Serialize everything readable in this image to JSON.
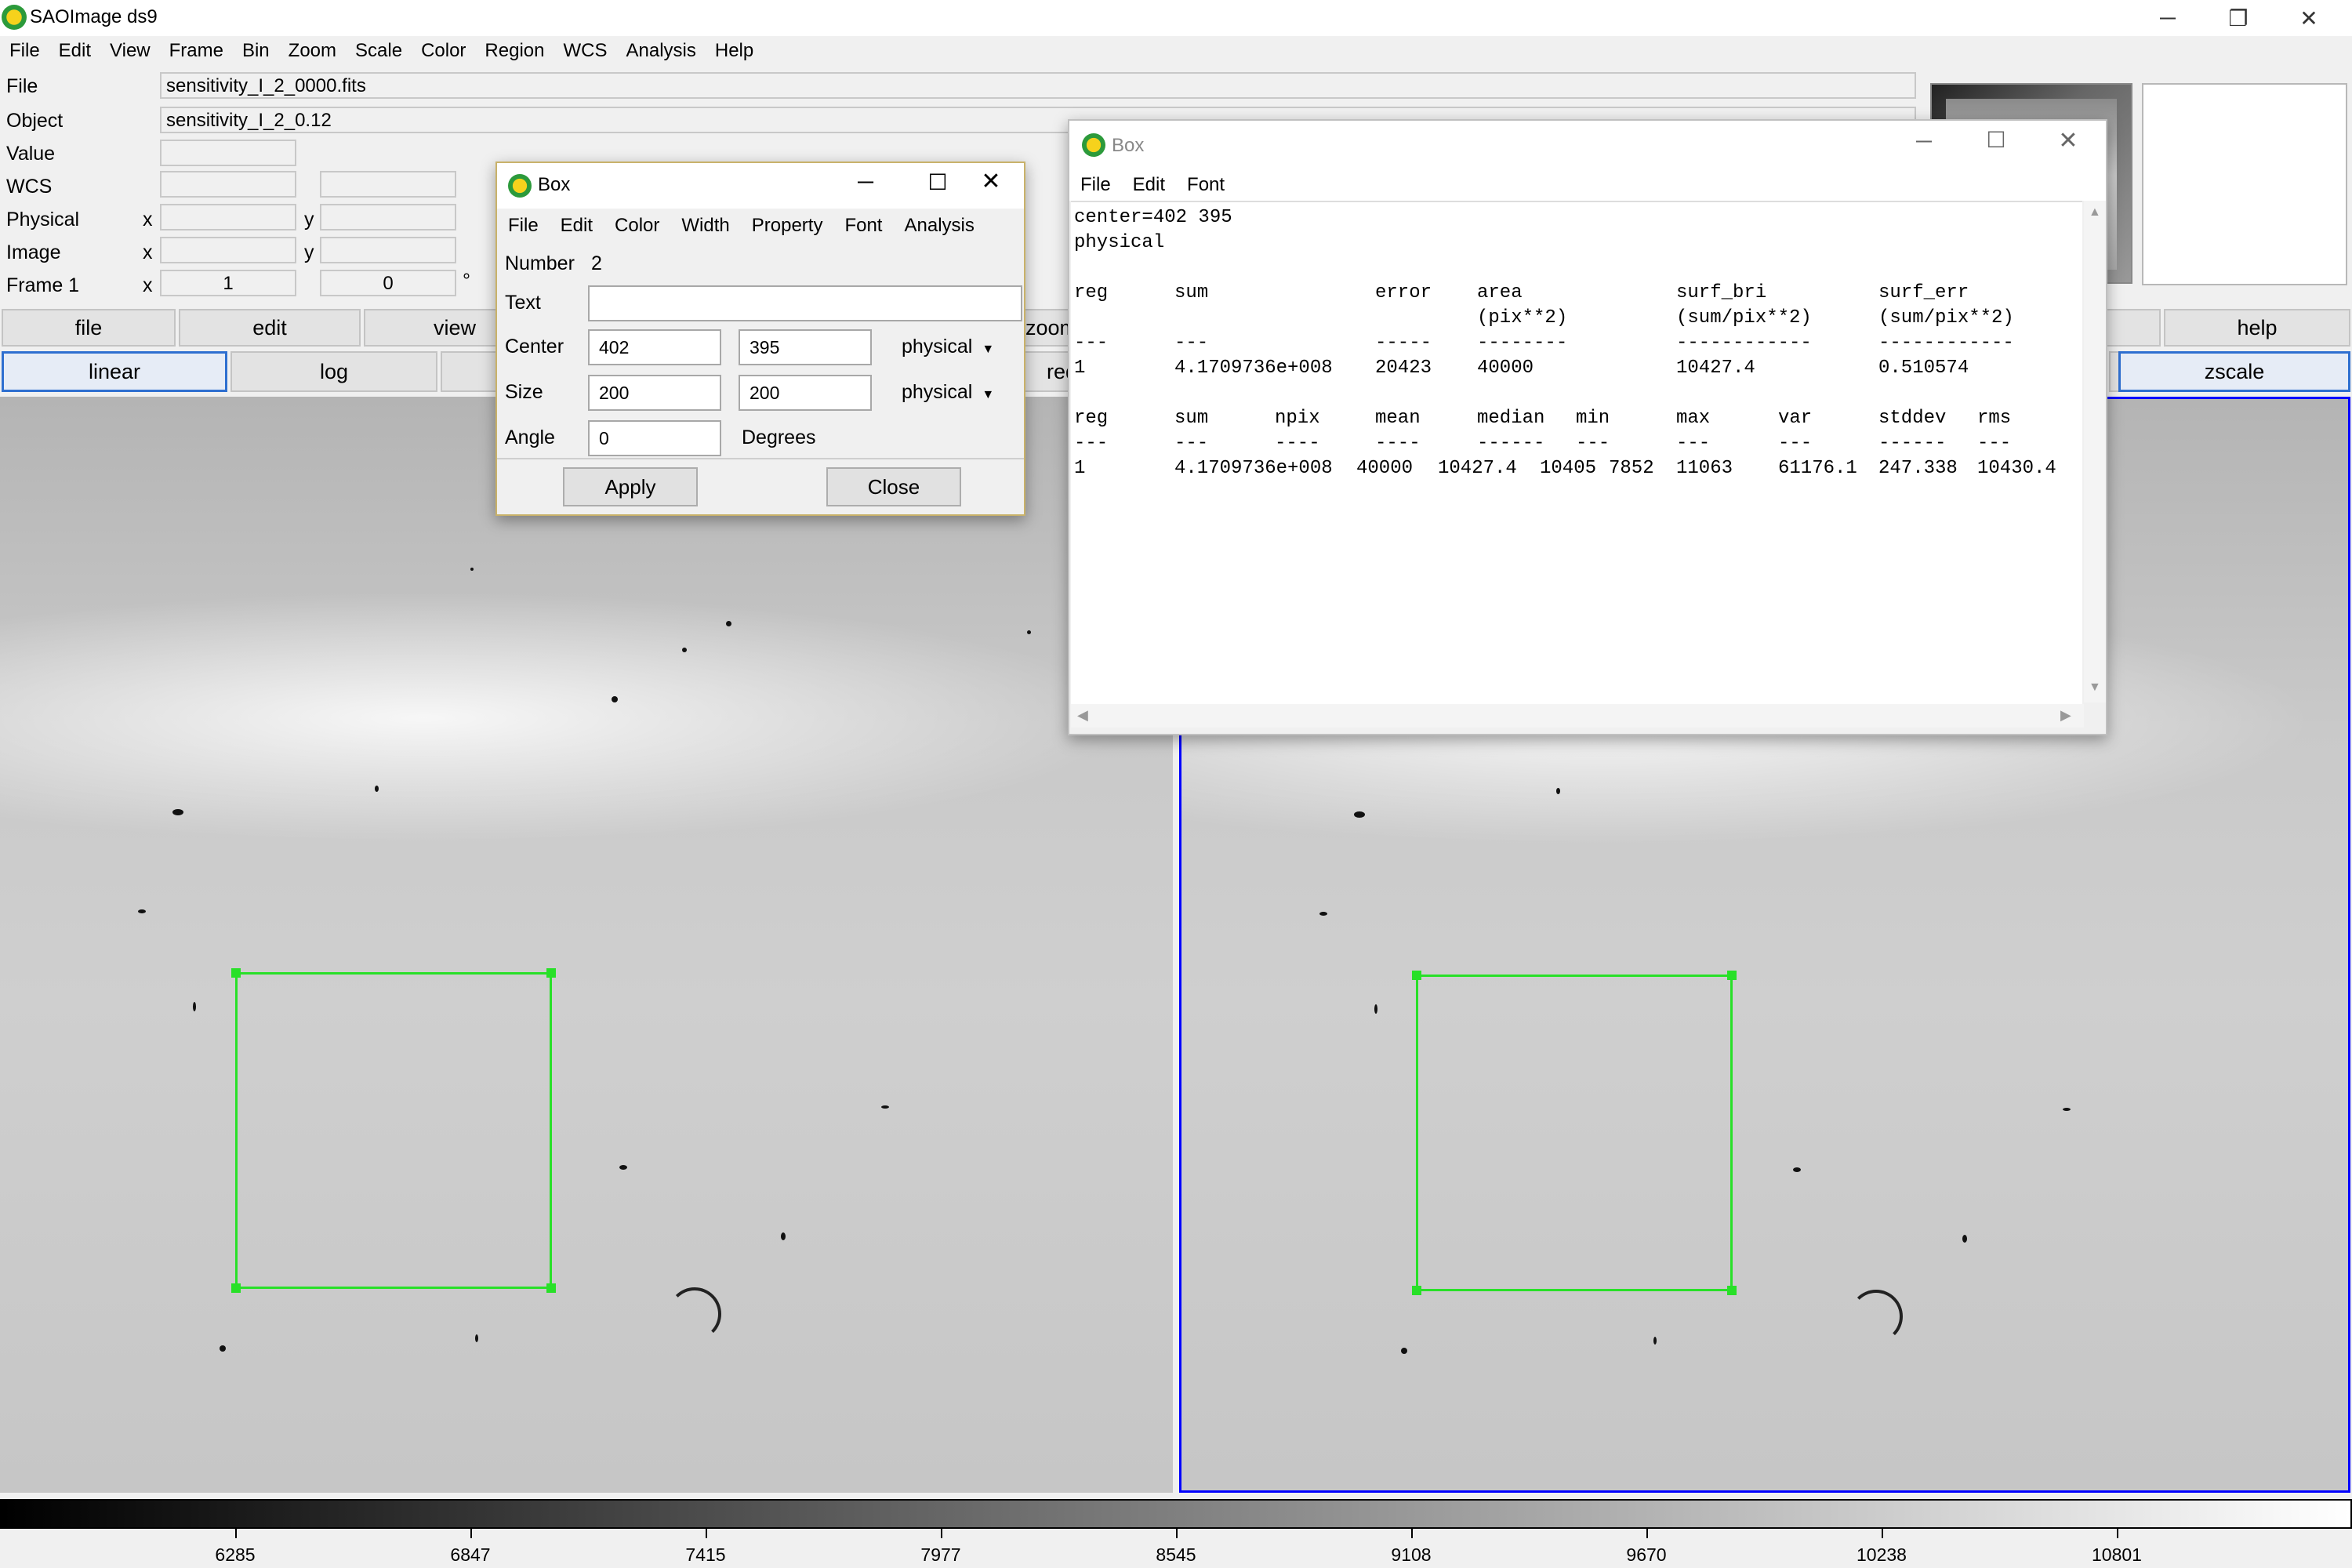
{
  "window": {
    "title": "SAOImage ds9",
    "controls": [
      "─",
      "❐",
      "✕"
    ]
  },
  "menubar": [
    "File",
    "Edit",
    "View",
    "Frame",
    "Bin",
    "Zoom",
    "Scale",
    "Color",
    "Region",
    "WCS",
    "Analysis",
    "Help"
  ],
  "info": {
    "file_label": "File",
    "file_value": "sensitivity_I_2_0000.fits",
    "object_label": "Object",
    "object_value": "sensitivity_I_2_0.12",
    "value_label": "Value",
    "wcs_label": "WCS",
    "physical_label": "Physical",
    "image_label": "Image",
    "frame_label": "Frame 1",
    "x_label": "x",
    "y_label": "y",
    "frame_x": "1",
    "frame_y": "0",
    "degree_symbol": "°"
  },
  "buttonbar": {
    "row1": [
      "file",
      "edit",
      "view",
      "zoom"
    ],
    "row1_right": "help",
    "row2": [
      "linear",
      "log"
    ],
    "row2_partial": "red",
    "row2_right": "zscale"
  },
  "box_dialog": {
    "title": "Box",
    "menu": [
      "File",
      "Edit",
      "Color",
      "Width",
      "Property",
      "Font",
      "Analysis"
    ],
    "number_label": "Number",
    "number_value": "2",
    "text_label": "Text",
    "text_value": "",
    "center_label": "Center",
    "center_x": "402",
    "center_y": "395",
    "center_coord": "physical",
    "size_label": "Size",
    "size_x": "200",
    "size_y": "200",
    "size_coord": "physical",
    "angle_label": "Angle",
    "angle_value": "0",
    "angle_unit": "Degrees",
    "apply_label": "Apply",
    "close_label": "Close"
  },
  "stats_window": {
    "title": "Box",
    "menu": [
      "File",
      "Edit",
      "Font"
    ],
    "center_line": "center=402 395",
    "system_line": "physical",
    "table1": {
      "headers": [
        "reg",
        "sum",
        "error",
        "area",
        "surf_bri",
        "surf_err"
      ],
      "subheaders": [
        "",
        "",
        "",
        "(pix**2)",
        "(sum/pix**2)",
        "(sum/pix**2)"
      ],
      "dashes": [
        "---",
        "---",
        "-----",
        "--------",
        "------------",
        "------------"
      ],
      "row": [
        "1",
        "4.1709736e+008",
        "20423",
        "40000",
        "10427.4",
        "0.510574"
      ]
    },
    "table2": {
      "headers": [
        "reg",
        "sum",
        "npix",
        "mean",
        "median",
        "min",
        "max",
        "var",
        "stddev",
        "rms"
      ],
      "dashes": [
        "---",
        "---",
        "----",
        "----",
        "------",
        "---",
        "---",
        "---",
        "------",
        "---"
      ],
      "row": [
        "1",
        "4.1709736e+008",
        "40000",
        "10427.4",
        "10405",
        "7852",
        "11063",
        "61176.1",
        "247.338",
        "10430.4"
      ]
    }
  },
  "colorbar": {
    "ticks": [
      "6285",
      "6847",
      "7415",
      "7977",
      "8545",
      "9108",
      "9670",
      "10238",
      "10801"
    ]
  },
  "colors": {
    "region": "#28e028",
    "selected_frame": "#0000ff",
    "selected_button": "#2e6fd0"
  }
}
